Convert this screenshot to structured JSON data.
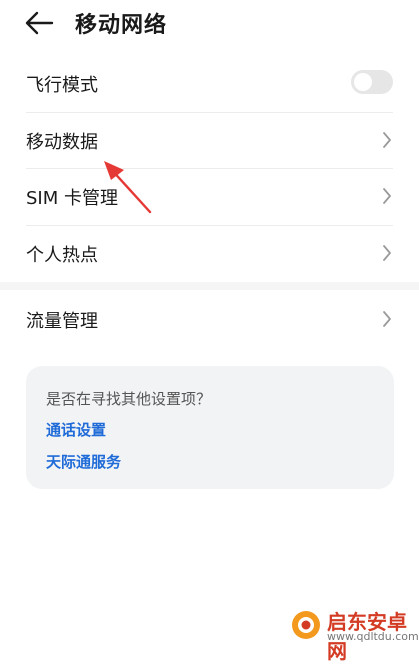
{
  "header": {
    "title": "移动网络"
  },
  "list1": [
    {
      "label": "飞行模式",
      "toggle": false
    },
    {
      "label": "移动数据"
    },
    {
      "label": "SIM 卡管理"
    },
    {
      "label": "个人热点"
    }
  ],
  "list2": [
    {
      "label": "流量管理"
    }
  ],
  "suggest": {
    "question": "是否在寻找其他设置项？",
    "links": [
      "通话设置",
      "天际通服务"
    ]
  },
  "watermark": {
    "text": "启东安卓网",
    "url": "www.qdltdu.com"
  },
  "colors": {
    "link": "#1f6bd8",
    "annotation_arrow": "#e53935",
    "watermark": "#d33b24"
  }
}
